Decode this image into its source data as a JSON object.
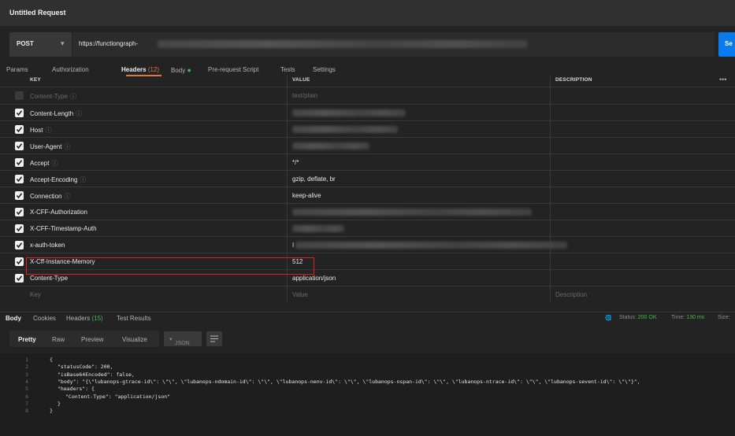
{
  "title": "Untitled Request",
  "request": {
    "method": "POST",
    "url": "https://functiongraph-",
    "send_label": "Se"
  },
  "tabs": {
    "params": "Params",
    "authorization": "Authorization",
    "headers": "Headers",
    "headers_count": "(12)",
    "body": "Body",
    "prerequest": "Pre-request Script",
    "tests": "Tests",
    "settings": "Settings"
  },
  "table": {
    "col_key": "KEY",
    "col_value": "VALUE",
    "col_description": "DESCRIPTION",
    "more": "•••",
    "rows": [
      {
        "key": "Content-Type",
        "value": "text/plain",
        "checked": false,
        "info": true
      },
      {
        "key": "Content-Length",
        "value": "",
        "checked": true,
        "info": true
      },
      {
        "key": "Host",
        "value": "",
        "checked": true,
        "info": true
      },
      {
        "key": "User-Agent",
        "value": "",
        "checked": true,
        "info": true
      },
      {
        "key": "Accept",
        "value": "*/*",
        "checked": true,
        "info": true
      },
      {
        "key": "Accept-Encoding",
        "value": "gzip, deflate, br",
        "checked": true,
        "info": true
      },
      {
        "key": "Connection",
        "value": "keep-alive",
        "checked": true,
        "info": true
      },
      {
        "key": "X-CFF-Authorization",
        "value": "",
        "checked": true,
        "info": false
      },
      {
        "key": "X-CFF-Timestamp-Auth",
        "value": "",
        "checked": true,
        "info": false
      },
      {
        "key": "x-auth-token",
        "value": "I",
        "checked": true,
        "info": false
      },
      {
        "key": "X-Cff-Instance-Memory",
        "value": "512",
        "checked": true,
        "info": false
      },
      {
        "key": "Content-Type",
        "value": "application/json",
        "checked": true,
        "info": false
      }
    ],
    "placeholder_key": "Key",
    "placeholder_value": "Value",
    "placeholder_description": "Description"
  },
  "response": {
    "tabs": {
      "body": "Body",
      "cookies": "Cookies",
      "headers": "Headers",
      "headers_count": "(15)",
      "test_results": "Test Results"
    },
    "status_label": "Status:",
    "status_value": "200 OK",
    "time_label": "Time:",
    "time_value": "130 ms",
    "size_label": "Size:",
    "view_tabs": {
      "pretty": "Pretty",
      "raw": "Raw",
      "preview": "Preview",
      "visualize": "Visualize"
    },
    "format": "JSON",
    "code_lines": [
      "{",
      "\"statusCode\": 200,",
      "\"isBase64Encoded\": false,",
      "\"body\": \"{\\\"lubanops-gtrace-id\\\": \\\"\\\", \\\"lubanops-ndomain-id\\\": \\\"\\\", \\\"lubanops-nenv-id\\\": \\\"\\\", \\\"lubanops-nspan-id\\\": \\\"\\\", \\\"lubanops-ntrace-id\\\": \\\"\\\", \\\"lubanops-sevent-id\\\": \\\"\\\"}\",",
      "\"headers\": {",
      "\"Content-Type\": \"application/json\"",
      "}",
      "}"
    ]
  }
}
